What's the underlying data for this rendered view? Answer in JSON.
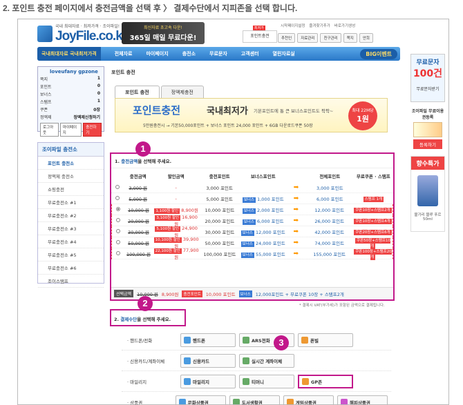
{
  "caption": "2. 포인트 충전 페이지에서 충전금액을 선택 후 〉 결제수단에서 지피존을 선택 합니다.",
  "header": {
    "tagline": "국내 최대자료 · 최저가격 · 조이파일!",
    "logo": "JoyFile.co.kr",
    "banner_line1": "최신자료 초고속 다운!",
    "banner_line2": "365일 매일 무료다운!",
    "point_charge": "포인트충전",
    "point_pop": "최저가",
    "top_links": [
      "시작페이지설정",
      "즐겨찾기추가",
      "바로가기생성"
    ],
    "quick": [
      "추천인",
      "자료관리",
      "친구관리",
      "쪽지",
      "안희"
    ]
  },
  "nav": {
    "lead": "국내최대자료 국내최저가격",
    "items": [
      "전체자료",
      "마이페이지",
      "충전소",
      "무료문자",
      "고객센터",
      "열린자료실"
    ],
    "event": "BIG이벤트"
  },
  "login": {
    "user": "loveufany gpzone",
    "rows": [
      {
        "label": "쪽지",
        "value": "1"
      },
      {
        "label": "포인트",
        "value": "0"
      },
      {
        "label": "보너스",
        "value": "0"
      },
      {
        "label": "스탬프",
        "value": "1"
      },
      {
        "label": "쿠폰",
        "value": "0장"
      },
      {
        "label": "정액제",
        "value": "정액제신청하기"
      }
    ],
    "btn_logout": "로그아웃",
    "btn_mypage": "마이페이지",
    "btn_charge": "충전하기"
  },
  "sidebar": {
    "title": "조이파일 충전소",
    "items": [
      "포인트 충전소",
      "정액제 충전소",
      "쇼핑충전",
      "무료충전소 #1",
      "무료충전소 #2",
      "무료충전소 #3",
      "무료충전소 #4",
      "무료충전소 #5",
      "무료충전소 #6",
      "조이스탬프"
    ]
  },
  "main": {
    "breadcrumb": "포인트 충전",
    "tabs": [
      "포인트 충전",
      "정액제충전"
    ],
    "promo_title": "포인트충전",
    "promo_title2": "국내최저가",
    "promo_sub": "기본포인트에 통 큰 보너스포인트도 팍팍~",
    "promo_line": "5만원충전시 → 기본50,000포인트 + 보너스 포인트 24,000 포인트 + 6GB 다운로드쿠폰 50장",
    "promo_circle_top": "최대 22M당",
    "promo_circle_big": "1원",
    "select_title_num": "1.",
    "select_title_hl": "충전금액",
    "select_title_rest": "을 선택해 주세요.",
    "columns": [
      "충전금액",
      "할인금액",
      "충전포인트",
      "보너스포인트",
      "전체포인트",
      "무료쿠폰 · 스탬프"
    ],
    "rows": [
      {
        "price": "3,000 원",
        "disc_tag": "",
        "disc": "-",
        "charge": "3,000 포인트",
        "bonus": "",
        "total": "3,000 포인트",
        "gift": "",
        "hot": false
      },
      {
        "price": "5,000 원",
        "disc_tag": "",
        "disc": "-",
        "charge": "5,000 포인트",
        "bonus": "1,000 포인트",
        "total": "6,000 포인트",
        "gift": "스탬프 1개",
        "hot": false
      },
      {
        "price": "10,000 원",
        "disc_tag": "1,100원 할인",
        "disc": "8,900원",
        "charge": "10,000 포인트",
        "bonus": "2,000 포인트",
        "total": "12,000 포인트",
        "gift": "쿠폰10장+스탬프2개",
        "hot": true
      },
      {
        "price": "20,000 원",
        "disc_tag": "3,100원 할인",
        "disc": "16,900원",
        "charge": "20,000 포인트",
        "bonus": "6,000 포인트",
        "total": "26,000 포인트",
        "gift": "쿠폰10장+스탬프4개",
        "hot": true
      },
      {
        "price": "30,000 원",
        "disc_tag": "5,100원 할인",
        "disc": "24,900원",
        "charge": "30,000 포인트",
        "bonus": "12,000 포인트",
        "total": "42,000 포인트",
        "gift": "쿠폰20장+스탬프6개",
        "hot": true
      },
      {
        "price": "50,000 원",
        "disc_tag": "10,100원 할인",
        "disc": "39,900원",
        "charge": "50,000 포인트",
        "bonus": "24,000 포인트",
        "total": "74,000 포인트",
        "gift": "쿠폰50장+스탬프10개",
        "hot": true
      },
      {
        "price": "100,000 원",
        "disc_tag": "22,100원 할인",
        "disc": "77,900원",
        "charge": "100,000 포인트",
        "bonus": "55,000 포인트",
        "total": "155,000 포인트",
        "gift": "쿠폰100장+스탬프20개",
        "hot": true
      }
    ],
    "total_label": "선택금액",
    "total_price": "10,000 원",
    "total_disc": "8,900원",
    "total_charge_tag": "충전포인트",
    "total_charge": "10,000 포인트",
    "total_bonus_tag": "보너스",
    "total_bonus": "12,000포인트 + 무료쿠폰 10장 + 스탬프2개",
    "note": "* 결제시 VAT(부가세)가 포함된 금액으로 결제됩니다.",
    "pay_num": "2.",
    "pay_hl": "결제수단",
    "pay_rest": "을 선택해 주세요.",
    "pay_rows": [
      {
        "label": "· 핸드폰/전화",
        "items": [
          "핸드폰",
          "ARS전화",
          "폰빌"
        ]
      },
      {
        "label": "· 신용카드/계좌이체",
        "items": [
          "신용카드",
          "실시간 계좌이체"
        ]
      },
      {
        "label": "· 마일리지",
        "items": [
          "마일리지",
          "티머니",
          "GP존"
        ]
      },
      {
        "label": "· 상품권",
        "items": [
          "문화상품권",
          "도서생활권",
          "게임상품권",
          "해피상품권"
        ]
      }
    ]
  },
  "right": {
    "sms_title": "무료문자",
    "sms_big": "100건",
    "sms_sub": "무료문자받기",
    "coupon_title": "조이파일 무료이용권등록",
    "coupon_btn": "등록하기",
    "perfume_title": "향수특가",
    "perfume_sub": "불가리 블루 푸르 50ml"
  },
  "badges": [
    "1",
    "2",
    "3"
  ]
}
